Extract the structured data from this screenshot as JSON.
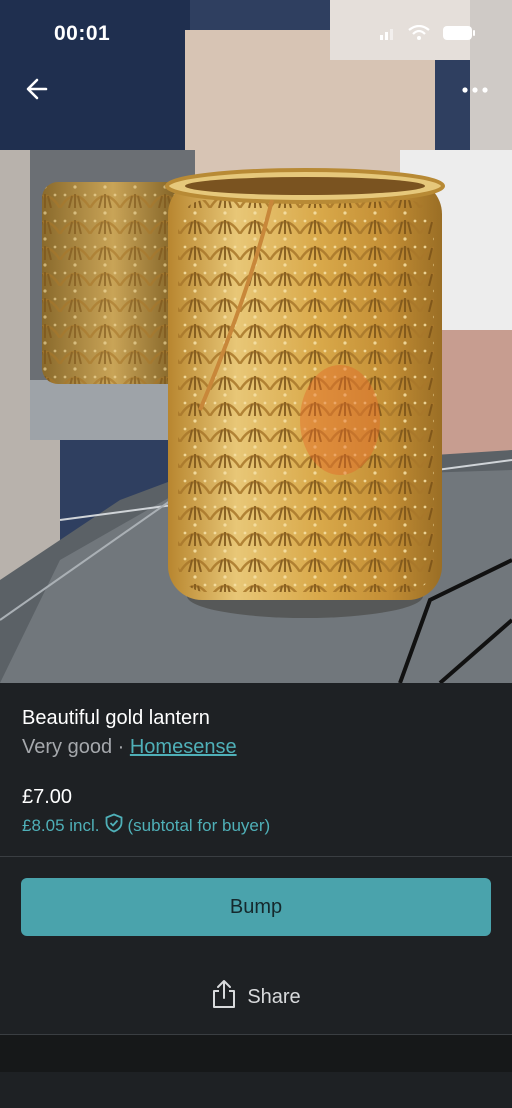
{
  "status_bar": {
    "time": "00:01"
  },
  "photo": {
    "subject": "gold lantern",
    "icons": [
      "back-arrow-icon",
      "more-dots-icon"
    ]
  },
  "listing": {
    "title": "Beautiful gold lantern",
    "condition": "Very good",
    "separator": " · ",
    "brand": "Homesense",
    "price": "£7.00",
    "buyer_price": "£8.05 incl.",
    "buyer_note": "(subtotal for buyer)"
  },
  "actions": {
    "bump_label": "Bump",
    "share_label": "Share"
  },
  "colors": {
    "accent": "#4aa3ac",
    "link": "#4fb0b8",
    "background": "#1e2124"
  }
}
